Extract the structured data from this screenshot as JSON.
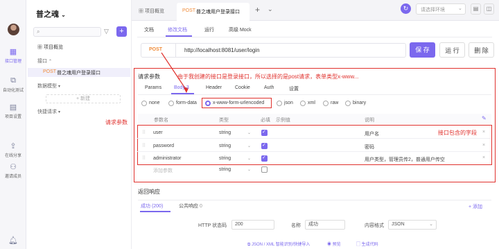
{
  "rail": {
    "items": [
      {
        "label": "接口管理"
      },
      {
        "label": "自动化测试"
      },
      {
        "label": "项目设置"
      },
      {
        "label": "在线分享"
      },
      {
        "label": "邀请成员"
      }
    ]
  },
  "tree": {
    "project_name": "普之魂",
    "project_overview": "项目概览",
    "api_section": "接口",
    "api_item_method": "POST",
    "api_item_name": "普之魂用户登录接口",
    "data_model": "数据模型",
    "new_label": "+ 新建",
    "quick_request": "快捷请求"
  },
  "tabs": {
    "tab1": "项目概览",
    "tab2_method": "POST",
    "tab2_name": "普之魂用户登录接口",
    "env_placeholder": "请选择环境"
  },
  "subtabs": [
    "文档",
    "修改文档",
    "运行",
    "高级 Mock"
  ],
  "request": {
    "method": "POST",
    "url": "http://localhost:8081/user/login",
    "save": "保 存",
    "run": "运 行",
    "delete": "删 除"
  },
  "params": {
    "title": "请求参数",
    "tabs": [
      "Params",
      "Body",
      "Header",
      "Cookie",
      "Auth",
      "设置"
    ],
    "body_count": "3",
    "body_types": [
      "none",
      "form-data",
      "x-www-form-urlencoded",
      "json",
      "xml",
      "raw",
      "binary"
    ],
    "columns": [
      "参数名",
      "类型",
      "必填",
      "示例值",
      "说明"
    ],
    "rows": [
      {
        "name": "user",
        "type": "string",
        "desc": "用户名"
      },
      {
        "name": "password",
        "type": "string",
        "desc": "密码"
      },
      {
        "name": "administrator",
        "type": "string",
        "desc": "用户类型，管理员传2，普通用户传空"
      }
    ],
    "add_row": "添加参数",
    "add_row_type": "string"
  },
  "annotations": {
    "top_note": "由于我创建的接口是登录接口，所以选择的是post请求，表单类型x-www...",
    "left_note": "请求参数",
    "right_note": "接口包含的字段"
  },
  "response": {
    "title": "返回响应",
    "success_tab": "成功 (200)",
    "public_tab": "公共响应",
    "public_count": "0",
    "add_label": "+ 添加",
    "http_code_label": "HTTP 状态码",
    "http_code_value": "200",
    "name_label": "名称",
    "name_value": "成功",
    "content_type_label": "内容格式",
    "content_type_value": "JSON",
    "footer_items": [
      "JSON / XML 智能识别/快捷导入",
      "预览",
      "生成代码"
    ]
  },
  "colors": {
    "accent": "#7b68ee",
    "annotation": "#e0312d",
    "post": "#f08c3a"
  }
}
